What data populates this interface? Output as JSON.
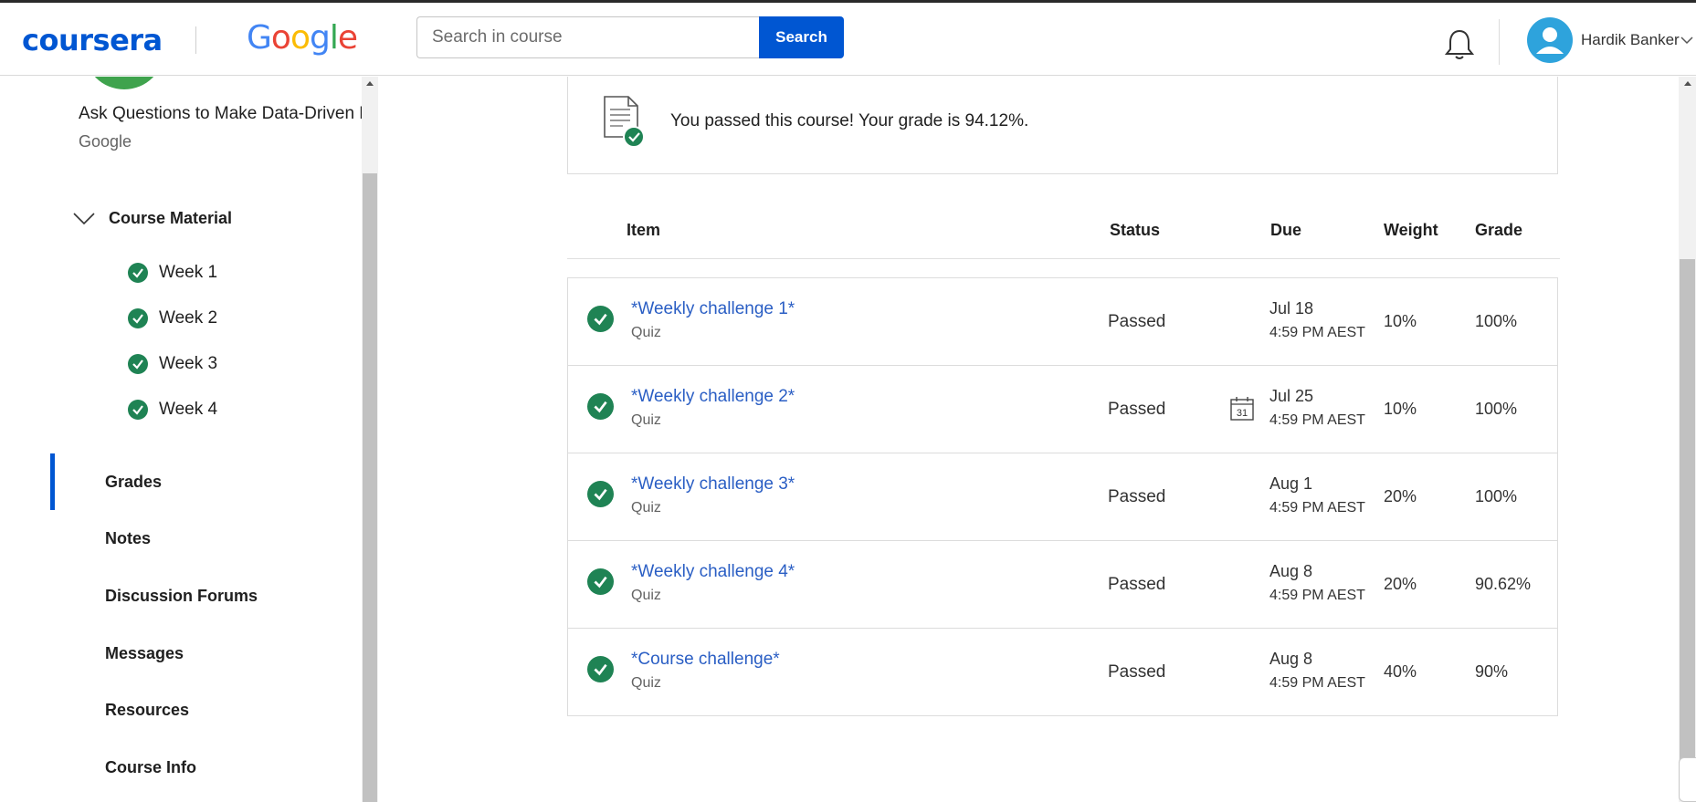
{
  "header": {
    "brand": "coursera",
    "partner_logo": "Google",
    "search_placeholder": "Search in course",
    "search_button": "Search",
    "notification_icon": "bell-icon",
    "user_name": "Hardik Banker",
    "colors": {
      "brand": "#0056d2",
      "success": "#1f8354"
    }
  },
  "sidebar": {
    "course_title": "Ask Questions to Make Data-Driven Decisions",
    "course_partner": "Google",
    "section_title": "Course Material",
    "weeks": [
      {
        "label": "Week 1"
      },
      {
        "label": "Week 2"
      },
      {
        "label": "Week 3"
      },
      {
        "label": "Week 4"
      }
    ],
    "nav": [
      {
        "label": "Grades",
        "active": true
      },
      {
        "label": "Notes"
      },
      {
        "label": "Discussion Forums"
      },
      {
        "label": "Messages"
      },
      {
        "label": "Resources"
      },
      {
        "label": "Course Info"
      }
    ]
  },
  "main": {
    "pass_message": "You passed this course! Your grade is 94.12%.",
    "columns": {
      "item": "Item",
      "status": "Status",
      "due": "Due",
      "weight": "Weight",
      "grade": "Grade"
    },
    "rows": [
      {
        "title": "*Weekly challenge 1*",
        "type": "Quiz",
        "status": "Passed",
        "due_date": "Jul 18",
        "due_time": "4:59 PM AEST",
        "weight": "10%",
        "grade": "100%",
        "calendar_icon": false
      },
      {
        "title": "*Weekly challenge 2*",
        "type": "Quiz",
        "status": "Passed",
        "due_date": "Jul 25",
        "due_time": "4:59 PM AEST",
        "weight": "10%",
        "grade": "100%",
        "calendar_icon": true,
        "calendar_day": "31"
      },
      {
        "title": "*Weekly challenge 3*",
        "type": "Quiz",
        "status": "Passed",
        "due_date": "Aug 1",
        "due_time": "4:59 PM AEST",
        "weight": "20%",
        "grade": "100%",
        "calendar_icon": false
      },
      {
        "title": "*Weekly challenge 4*",
        "type": "Quiz",
        "status": "Passed",
        "due_date": "Aug 8",
        "due_time": "4:59 PM AEST",
        "weight": "20%",
        "grade": "90.62%",
        "calendar_icon": false
      },
      {
        "title": "*Course challenge*",
        "type": "Quiz",
        "status": "Passed",
        "due_date": "Aug 8",
        "due_time": "4:59 PM AEST",
        "weight": "40%",
        "grade": "90%",
        "calendar_icon": false
      }
    ]
  }
}
